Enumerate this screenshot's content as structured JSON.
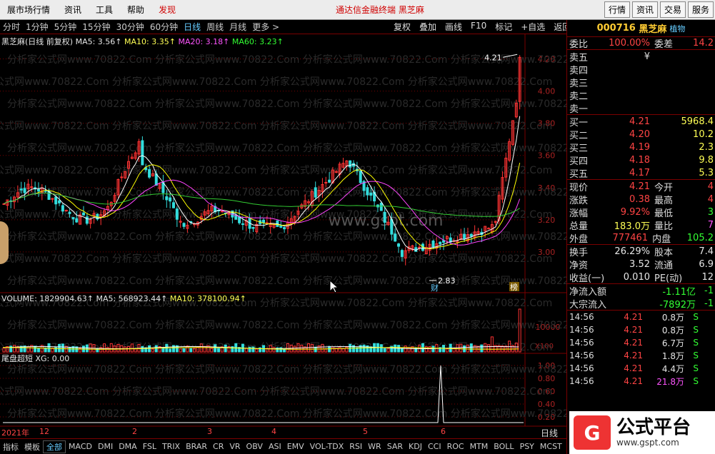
{
  "menubar": {
    "items": [
      "展市场行情",
      "资讯",
      "工具",
      "帮助",
      "发现"
    ],
    "center_title": "通达信金融终端   黑芝麻",
    "right_buttons": [
      "行情",
      "资讯",
      "交易",
      "服务"
    ]
  },
  "periodbar": {
    "periods": [
      "分时",
      "1分钟",
      "5分钟",
      "15分钟",
      "30分钟",
      "60分钟",
      "日线",
      "周线",
      "月线",
      "更多 >"
    ],
    "active": "日线",
    "tools": [
      "复权",
      "叠加",
      "画线",
      "F10",
      "标记",
      "+自选",
      "返回"
    ]
  },
  "main_legend": {
    "title": "黑芝麻(日线 前复权)",
    "ma5": "MA5: 3.56↑",
    "ma10": "MA10: 3.35↑",
    "ma20": "MA20: 3.18↑",
    "ma60": "MA60: 3.23↑"
  },
  "volume_legend": {
    "volume": "VOLUME: 1829904.63↑",
    "ma5": "MA5: 568923.44↑",
    "ma10": "MA10: 378100.94↑"
  },
  "indicator_legend": {
    "name": "尾盘超短",
    "xg": "XG: 0.00"
  },
  "price_axis": [
    "4.20",
    "4.00",
    "3.80",
    "3.60",
    "3.40",
    "3.20",
    "3.00"
  ],
  "volume_axis": [
    "10000",
    "X100"
  ],
  "ind_axis": [
    "1.00",
    "0.80",
    "0.60",
    "0.40",
    "0.20"
  ],
  "annotations": {
    "high": "4.21",
    "low": "2.83",
    "low_tag": "财",
    "high_tag": "榜"
  },
  "watermark_text": "分析家公式网www.70822.Com",
  "watermark_center": "www.gspt.com",
  "datebar": {
    "labels": [
      "2021年",
      "12",
      "2",
      "3",
      "4",
      "5",
      "6"
    ]
  },
  "day_label": "日线",
  "tabs": [
    "指标",
    "模板",
    "全部",
    "MACD",
    "DMI",
    "DMA",
    "FSL",
    "TRIX",
    "BRAR",
    "CR",
    "VR",
    "OBV",
    "ASI",
    "EMV",
    "VOL-TDX",
    "RSI",
    "WR",
    "SAR",
    "KDJ",
    "CCI",
    "ROC",
    "MTM",
    "BOLL",
    "PSY",
    "MCST"
  ],
  "active_tab": "全部",
  "quote": {
    "code": "000716",
    "name": "黑芝麻",
    "tag": "植物",
    "weibi_label": "委比",
    "weibi": "100.00%",
    "weicha_label": "委差",
    "weicha": "14.2",
    "sells": [
      {
        "label": "卖五",
        "price": "",
        "vol": ""
      },
      {
        "label": "卖四",
        "price": "",
        "vol": ""
      },
      {
        "label": "卖三",
        "price": "",
        "vol": ""
      },
      {
        "label": "卖二",
        "price": "",
        "vol": ""
      },
      {
        "label": "卖一",
        "price": "",
        "vol": ""
      }
    ],
    "sell5_extra": "¥",
    "buys": [
      {
        "label": "买一",
        "price": "4.21",
        "vol": "5968.4"
      },
      {
        "label": "买二",
        "price": "4.20",
        "vol": "10.2"
      },
      {
        "label": "买三",
        "price": "4.19",
        "vol": "2.3"
      },
      {
        "label": "买四",
        "price": "4.18",
        "vol": "9.8"
      },
      {
        "label": "买五",
        "price": "4.17",
        "vol": "5.3"
      }
    ],
    "stats": [
      {
        "l1": "现价",
        "v1": "4.21",
        "c1": "red",
        "l2": "今开",
        "v2": "4",
        "c2": "red"
      },
      {
        "l1": "涨跌",
        "v1": "0.38",
        "c1": "red",
        "l2": "最高",
        "v2": "4",
        "c2": "red"
      },
      {
        "l1": "涨幅",
        "v1": "9.92%",
        "c1": "red",
        "l2": "最低",
        "v2": "3",
        "c2": "green"
      },
      {
        "l1": "总量",
        "v1": "183.0万",
        "c1": "yellow",
        "l2": "量比",
        "v2": "7",
        "c2": "magenta"
      },
      {
        "l1": "外盘",
        "v1": "777461",
        "c1": "red",
        "l2": "内盘",
        "v2": "105.2",
        "c2": "green"
      }
    ],
    "stats2": [
      {
        "l1": "换手",
        "v1": "26.29%",
        "c1": "white",
        "l2": "股本",
        "v2": "7.4",
        "c2": "white"
      },
      {
        "l1": "净资",
        "v1": "3.52",
        "c1": "white",
        "l2": "流通",
        "v2": "6.9",
        "c2": "white"
      },
      {
        "l1": "收益(一)",
        "v1": "0.010",
        "c1": "white",
        "l2": "PE(动)",
        "v2": "12",
        "c2": "white"
      }
    ],
    "flows": [
      {
        "label": "净流入额",
        "v": "-1.11亿",
        "v2": "-1"
      },
      {
        "label": "大宗流入",
        "v": "-7892万",
        "v2": "-1"
      }
    ],
    "ticks": [
      {
        "t": "14:56",
        "p": "4.21",
        "v": "0.8万",
        "s": "S",
        "c": "white"
      },
      {
        "t": "14:56",
        "p": "4.21",
        "v": "0.8万",
        "s": "S",
        "c": "white"
      },
      {
        "t": "14:56",
        "p": "4.21",
        "v": "6.7万",
        "s": "S",
        "c": "white"
      },
      {
        "t": "14:56",
        "p": "4.21",
        "v": "1.8万",
        "s": "S",
        "c": "white"
      },
      {
        "t": "14:56",
        "p": "4.21",
        "v": "4.4万",
        "s": "S",
        "c": "white"
      },
      {
        "t": "14:56",
        "p": "4.21",
        "v": "21.8万",
        "s": "S",
        "c": "magenta"
      }
    ]
  },
  "logo": {
    "big": "公式平台",
    "small": "www.gspt.com"
  },
  "colors": {
    "up": "#ff3333",
    "down": "#33dddd",
    "ma5": "#ffffff",
    "ma10": "#ffff00",
    "ma20": "#ff44ff",
    "ma60": "#33cc33",
    "grid": "#7a0000"
  }
}
